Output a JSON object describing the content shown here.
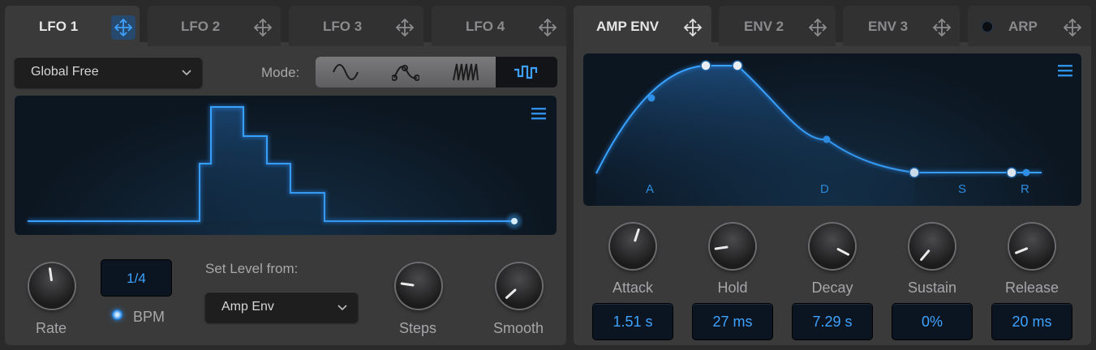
{
  "lfo_tabs": [
    {
      "label": "LFO 1",
      "active": true
    },
    {
      "label": "LFO 2",
      "active": false
    },
    {
      "label": "LFO 3",
      "active": false
    },
    {
      "label": "LFO 4",
      "active": false
    }
  ],
  "env_tabs": [
    {
      "label": "AMP ENV",
      "active": true
    },
    {
      "label": "ENV 2",
      "active": false
    },
    {
      "label": "ENV 3",
      "active": false
    },
    {
      "label": "ARP",
      "active": false
    }
  ],
  "lfo": {
    "sync_mode": "Global Free",
    "mode_label": "Mode:",
    "modes": [
      "sine",
      "smooth-random",
      "sawtooth",
      "stepped"
    ],
    "selected_mode": "stepped",
    "rate": {
      "label": "Rate",
      "value": "1/4",
      "bpm_label": "BPM",
      "bpm_on": true
    },
    "set_level_label": "Set Level from:",
    "set_level_value": "Amp Env",
    "steps_label": "Steps",
    "smooth_label": "Smooth"
  },
  "amp_env": {
    "letters": [
      "A",
      "D",
      "S",
      "R"
    ],
    "knobs": [
      {
        "label": "Attack",
        "value": "1.51 s"
      },
      {
        "label": "Hold",
        "value": "27 ms"
      },
      {
        "label": "Decay",
        "value": "7.29 s"
      },
      {
        "label": "Sustain",
        "value": "0%"
      },
      {
        "label": "Release",
        "value": "20 ms"
      }
    ]
  },
  "colors": {
    "accent": "#2e8fe6",
    "value_text": "#3ea3ff",
    "panel": "#3a3a3b",
    "background": "#2a2a2b"
  },
  "icons": [
    "move-icon",
    "menu-icon",
    "chevron-down-icon",
    "sine-wave-icon",
    "random-wave-icon",
    "saw-wave-icon",
    "step-wave-icon"
  ]
}
